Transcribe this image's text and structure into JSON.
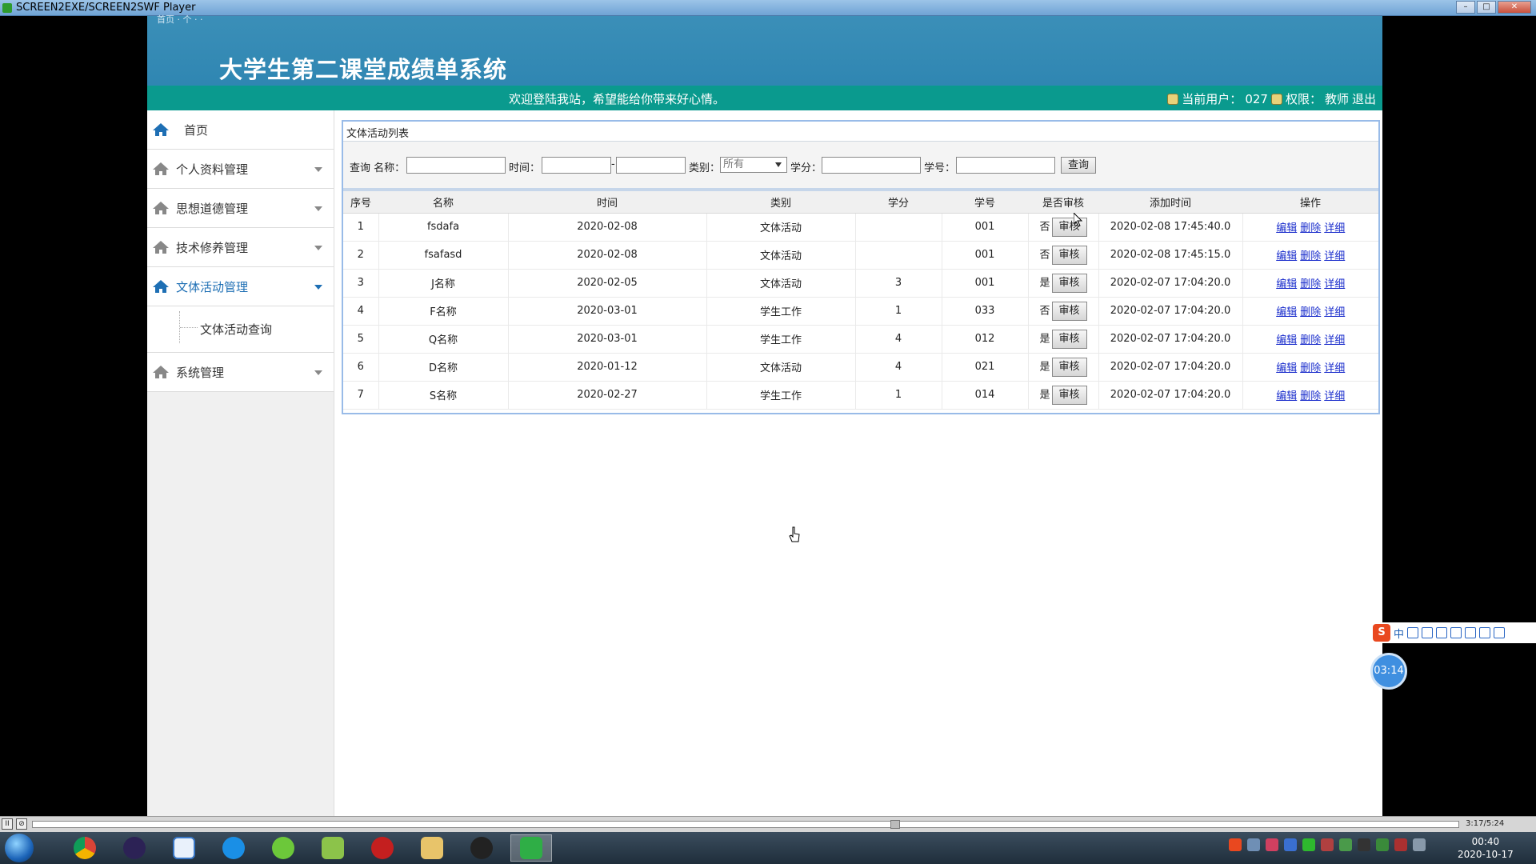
{
  "player": {
    "title": "SCREEN2EXE/SCREEN2SWF Player",
    "btn_minimize": "–",
    "btn_maximize": "□",
    "btn_close": "✕",
    "play_time": "3:17/5:24"
  },
  "header": {
    "small_text": "首页 · 个 · ·",
    "system_title": "大学生第二课堂成绩单系统",
    "welcome": "欢迎登陆我站，希望能给你带来好心情。",
    "current_user_label": "当前用户：",
    "current_user": "027",
    "role_label": "权限：",
    "role": "教师",
    "logout": "退出"
  },
  "sidebar": {
    "home": "首页",
    "items": [
      {
        "label": "个人资料管理"
      },
      {
        "label": "思想道德管理"
      },
      {
        "label": "技术修养管理"
      },
      {
        "label": "文体活动管理"
      }
    ],
    "sub_item": "文体活动查询",
    "last_item": "系统管理"
  },
  "panel": {
    "title": "文体活动列表",
    "query": {
      "prefix": "查询 名称：",
      "time_label": "时间：",
      "separator": "-",
      "category_label": "类别：",
      "category_value": "所有",
      "credit_label": "学分：",
      "student_label": "学号：",
      "search_button": "查询"
    }
  },
  "table": {
    "headers": [
      "序号",
      "名称",
      "时间",
      "类别",
      "学分",
      "学号",
      "是否审核",
      "添加时间",
      "操作"
    ],
    "audit_button": "审核",
    "op_edit": "编辑",
    "op_delete": "删除",
    "op_detail": "详细",
    "rows": [
      {
        "no": "1",
        "name": "fsdafa",
        "time": "2020-02-08",
        "category": "文体活动",
        "credit": "",
        "student": "001",
        "audited": "否",
        "added": "2020-02-08 17:45:40.0"
      },
      {
        "no": "2",
        "name": "fsafasd",
        "time": "2020-02-08",
        "category": "文体活动",
        "credit": "",
        "student": "001",
        "audited": "否",
        "added": "2020-02-08 17:45:15.0"
      },
      {
        "no": "3",
        "name": "J名称",
        "time": "2020-02-05",
        "category": "文体活动",
        "credit": "3",
        "student": "001",
        "audited": "是",
        "added": "2020-02-07 17:04:20.0"
      },
      {
        "no": "4",
        "name": "F名称",
        "time": "2020-03-01",
        "category": "学生工作",
        "credit": "1",
        "student": "033",
        "audited": "否",
        "added": "2020-02-07 17:04:20.0"
      },
      {
        "no": "5",
        "name": "Q名称",
        "time": "2020-03-01",
        "category": "学生工作",
        "credit": "4",
        "student": "012",
        "audited": "是",
        "added": "2020-02-07 17:04:20.0"
      },
      {
        "no": "6",
        "name": "D名称",
        "time": "2020-01-12",
        "category": "文体活动",
        "credit": "4",
        "student": "021",
        "audited": "是",
        "added": "2020-02-07 17:04:20.0"
      },
      {
        "no": "7",
        "name": "S名称",
        "time": "2020-02-27",
        "category": "学生工作",
        "credit": "1",
        "student": "014",
        "audited": "是",
        "added": "2020-02-07 17:04:20.0"
      }
    ]
  },
  "overlay": {
    "ime_lang": "中",
    "ime_s": "S",
    "timer": "03:14"
  },
  "taskbar": {
    "apps": [
      "chrome-icon",
      "eclipse-icon",
      "network-icon",
      "qq-browser-icon",
      "leaf-icon",
      "chart-icon",
      "flash-icon",
      "folder-icon",
      "qq-icon",
      "screen-recorder-icon"
    ],
    "clock_time": "00:40",
    "clock_date": "2020-10-17"
  },
  "colors": {
    "banner": "#2f86b2",
    "welcome_bar": "#0a9a8e",
    "accent": "#1e6fb4"
  }
}
